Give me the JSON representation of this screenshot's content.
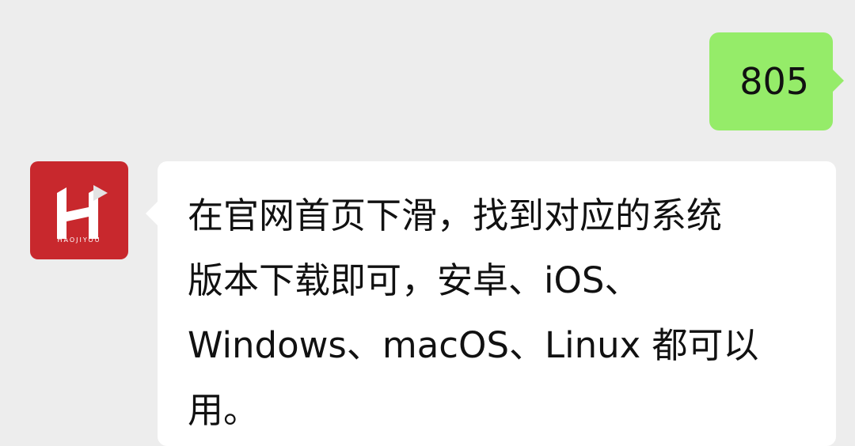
{
  "outgoing": {
    "text": "805",
    "bubble_color": "#95ec69"
  },
  "incoming": {
    "avatar": {
      "icon": "haojiyou-logo-icon",
      "brand_text": "HAOJIYOU",
      "color": "#c8282d"
    },
    "lines": [
      "在官网首页下滑，找到对应的系统",
      "版本下载即可，安卓、iOS、",
      "Windows、macOS、Linux 都可以",
      "用。"
    ],
    "bubble_color": "#ffffff"
  },
  "background_color": "#ededed"
}
